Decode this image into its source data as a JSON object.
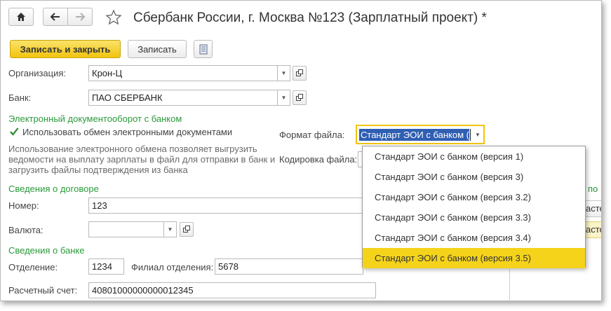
{
  "window": {
    "title": "Сбербанк России, г. Москва №123 (Зарплатный проект) *"
  },
  "toolbar": {
    "save_close_label": "Записать и закрыть",
    "save_label": "Записать"
  },
  "organization": {
    "label": "Организация:",
    "value": "Крон-Ц"
  },
  "bank": {
    "label": "Банк:",
    "value": "ПАО СБЕРБАНК"
  },
  "edo": {
    "section_title": "Электронный документооборот с банком",
    "checkbox_label": "Использовать обмен электронными документами",
    "checked": true,
    "hint_line1": "Использование электронного обмена позволяет выгрузить",
    "hint_line2": "ведомости на выплату зарплаты в файл для отправки в банк и",
    "hint_line3": "загрузить файлы подтверждения из банка",
    "format_label": "Формат файла:",
    "format_value": "Стандарт ЭОИ с банком (",
    "encoding_label": "Кодировка файла:"
  },
  "format_options": [
    {
      "label": "Стандарт ЭОИ с банком (версия 1)",
      "selected": false
    },
    {
      "label": "Стандарт ЭОИ с банком (версия 3)",
      "selected": false
    },
    {
      "label": "Стандарт ЭОИ с банком (версия 3.2)",
      "selected": false
    },
    {
      "label": "Стандарт ЭОИ с банком (версия 3.3)",
      "selected": false
    },
    {
      "label": "Стандарт ЭОИ с банком (версия 3.4)",
      "selected": false
    },
    {
      "label": "Стандарт ЭОИ с банком (версия 3.5)",
      "selected": true
    }
  ],
  "contract": {
    "section_title": "Сведения о договоре",
    "number_label": "Номер:",
    "number_value": "123",
    "currency_label": "Валюта:",
    "currency_value": ""
  },
  "bank_info": {
    "section_title": "Сведения о банке",
    "branch_label": "Отделение:",
    "branch_value": "1234",
    "subbranch_label": "Филиал отделения:",
    "subbranch_value": "5678",
    "account_label": "Расчетный счет:",
    "account_value": "40801000000000012345"
  },
  "right_panel": {
    "link_fragment": "по",
    "btn1_fragment": "асте",
    "btn2_fragment": "асте"
  },
  "colors": {
    "accent_yellow": "#f1c40f",
    "section_green": "#2a9a3a",
    "selection_blue": "#2f5eb3"
  }
}
